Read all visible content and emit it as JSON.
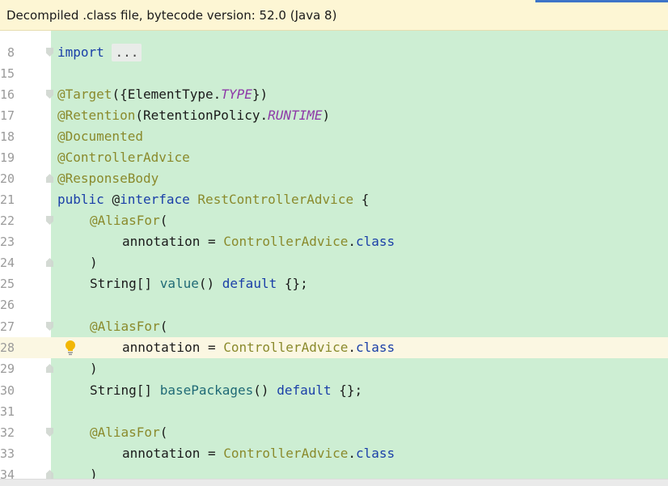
{
  "banner": {
    "text": "Decompiled .class file, bytecode version: 52.0 (Java 8)"
  },
  "editor": {
    "lines": [
      {
        "ln": "8"
      },
      {
        "ln": "15"
      },
      {
        "ln": "16"
      },
      {
        "ln": "17"
      },
      {
        "ln": "18"
      },
      {
        "ln": "19"
      },
      {
        "ln": "20"
      },
      {
        "ln": "21"
      },
      {
        "ln": "22"
      },
      {
        "ln": "23"
      },
      {
        "ln": "24"
      },
      {
        "ln": "25"
      },
      {
        "ln": "26"
      },
      {
        "ln": "27"
      },
      {
        "ln": "28"
      },
      {
        "ln": "29"
      },
      {
        "ln": "30"
      },
      {
        "ln": "31"
      },
      {
        "ln": "32"
      },
      {
        "ln": "33"
      },
      {
        "ln": "34"
      }
    ],
    "tokens": {
      "import_kw": "import",
      "import_folded": "...",
      "target": "@Target",
      "target_args_open": "({ElementType.",
      "target_type": "TYPE",
      "target_args_close": "})",
      "retention": "@Retention",
      "retention_args_open": "(RetentionPolicy.",
      "retention_runtime": "RUNTIME",
      "retention_args_close": ")",
      "documented": "@Documented",
      "controller_advice": "@ControllerAdvice",
      "response_body": "@ResponseBody",
      "public_kw": "public",
      "at_sign": "@",
      "interface_kw": "interface",
      "class_name": "RestControllerAdvice",
      "brace_open": "{",
      "alias_for": "@AliasFor",
      "paren_open": "(",
      "annotation_assign": "annotation = ",
      "controller_advice_ref": "ControllerAdvice",
      "dot": ".",
      "class_kw": "class",
      "paren_close": ")",
      "string_array": "String[] ",
      "method_value": "value",
      "method_parens": "() ",
      "default_kw": "default",
      "default_value": " {};",
      "method_base_packages": "basePackages"
    }
  },
  "icons": {
    "intention": "lightbulb-icon",
    "fold": "fold-marker-icon"
  },
  "colors": {
    "banner_bg": "#fdf6d4",
    "diff_green": "#cdeed3",
    "keyword": "#1a3fa8",
    "annotation": "#8a8a2c",
    "enum_constant": "#8e3aa8",
    "method": "#1f6a76",
    "current_line": "#fbf7e2"
  }
}
